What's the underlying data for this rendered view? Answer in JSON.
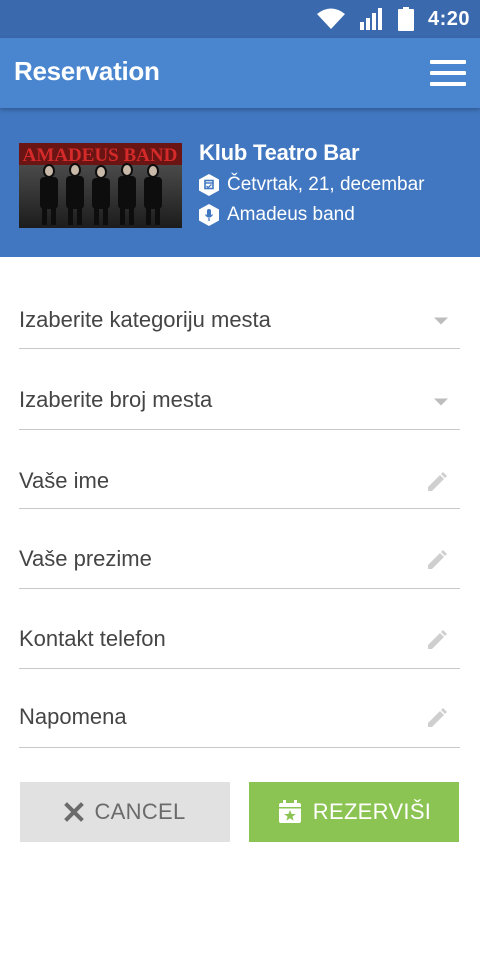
{
  "status_bar": {
    "time": "4:20",
    "icons": [
      "wifi-icon",
      "signal-icon",
      "battery-icon"
    ]
  },
  "app_bar": {
    "title": "Reservation",
    "menu_icon": "hamburger-menu-icon"
  },
  "event": {
    "image_text": "AMADEUS BAND",
    "venue": "Klub Teatro Bar",
    "date": "Četvrtak, 21, decembar",
    "performer": "Amadeus band",
    "date_icon": "calendar-hex-icon",
    "performer_icon": "microphone-hex-icon"
  },
  "form": {
    "fields": [
      {
        "label": "Izaberite kategoriju mesta",
        "type": "dropdown"
      },
      {
        "label": "Izaberite broj mesta",
        "type": "dropdown"
      },
      {
        "label": "Vaše ime",
        "type": "text"
      },
      {
        "label": "Vaše prezime",
        "type": "text"
      },
      {
        "label": "Kontakt telefon",
        "type": "text"
      },
      {
        "label": "Napomena",
        "type": "text"
      }
    ]
  },
  "buttons": {
    "cancel_label": "CANCEL",
    "reserve_label": "REZERVIŠI"
  },
  "colors": {
    "status_bar": "#3a69ae",
    "app_bar": "#4a86d0",
    "event_header": "#4177c0",
    "reserve_button": "#8bc452",
    "cancel_button": "#e1e1e1"
  }
}
